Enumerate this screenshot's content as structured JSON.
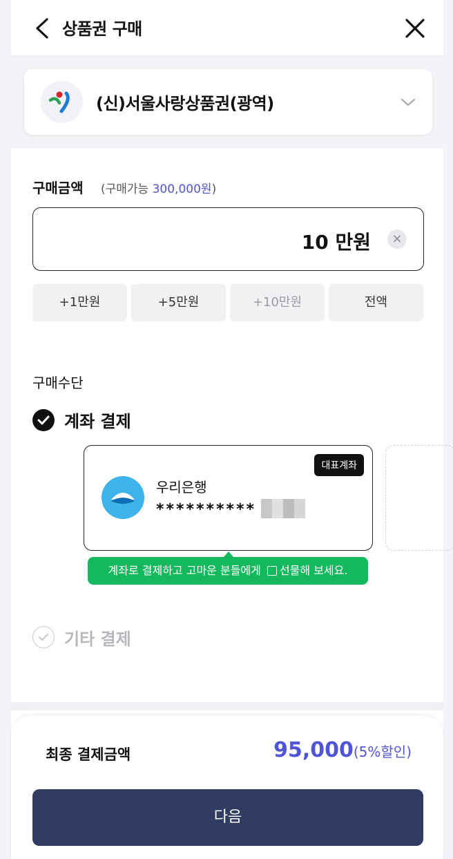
{
  "header": {
    "title": "상품권 구매"
  },
  "voucher": {
    "selected": "(신)서울사랑상품권(광역)"
  },
  "amount": {
    "label": "구매금액",
    "available_prefix": "(구매가능 ",
    "available_value": "300,000원",
    "available_suffix": ")",
    "value": "10 만원",
    "chips": [
      "+1만원",
      "+5만원",
      "+10만원",
      "전액"
    ]
  },
  "method": {
    "label": "구매수단",
    "primary": "계좌 결제",
    "account": {
      "badge": "대표계좌",
      "bank": "우리은행",
      "number": "**********"
    },
    "tip_left": "계좌로 결제하고 고마운 분들에게",
    "tip_right": "선물해 보세요.",
    "other": "기타 결제"
  },
  "footer": {
    "final_label": "최종 결제금액",
    "final_amount": "95,000",
    "discount": "(5%할인)",
    "next": "다음"
  },
  "colors": {
    "accent": "#4f55d6",
    "primary_button": "#313c63",
    "tip": "#14b95d"
  }
}
